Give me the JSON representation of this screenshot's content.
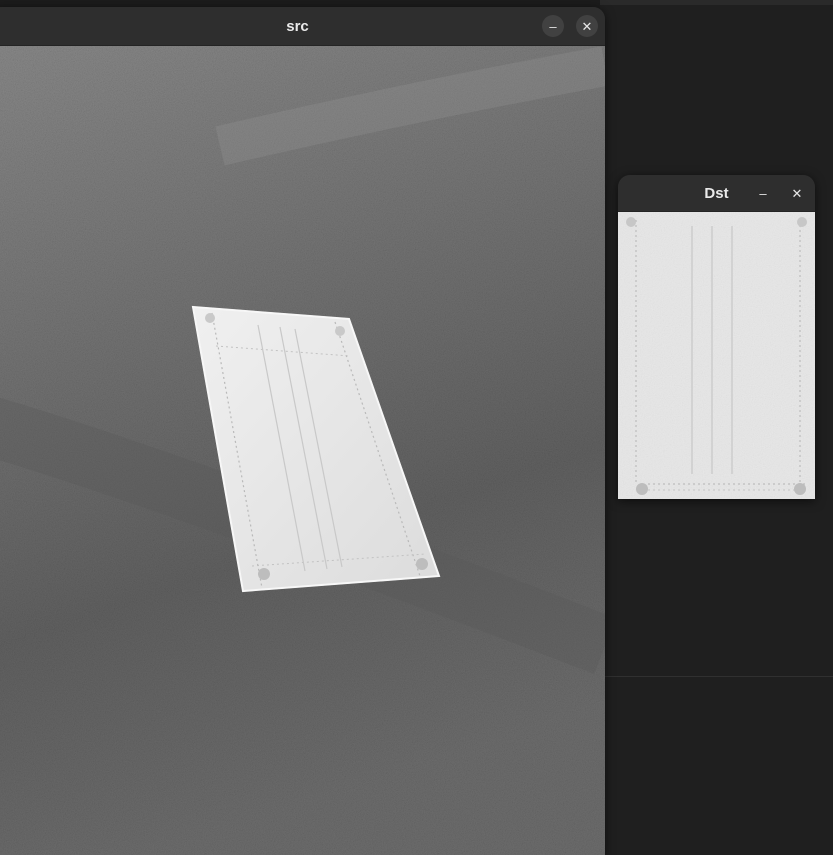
{
  "windows": {
    "src": {
      "title": "src",
      "minimize_glyph": "–",
      "close_glyph": "✕"
    },
    "dst": {
      "title": "Dst",
      "minimize_glyph": "–",
      "close_glyph": "✕"
    }
  },
  "icons": {
    "minimize": "minimize-icon",
    "close": "close-icon"
  },
  "colors": {
    "desktop_bg": "#1c1c1c",
    "titlebar_bg": "#2e2e2e",
    "title_text": "#eaeaea",
    "asphalt": "#6f6f6f",
    "mask": "#e6e6e6"
  }
}
